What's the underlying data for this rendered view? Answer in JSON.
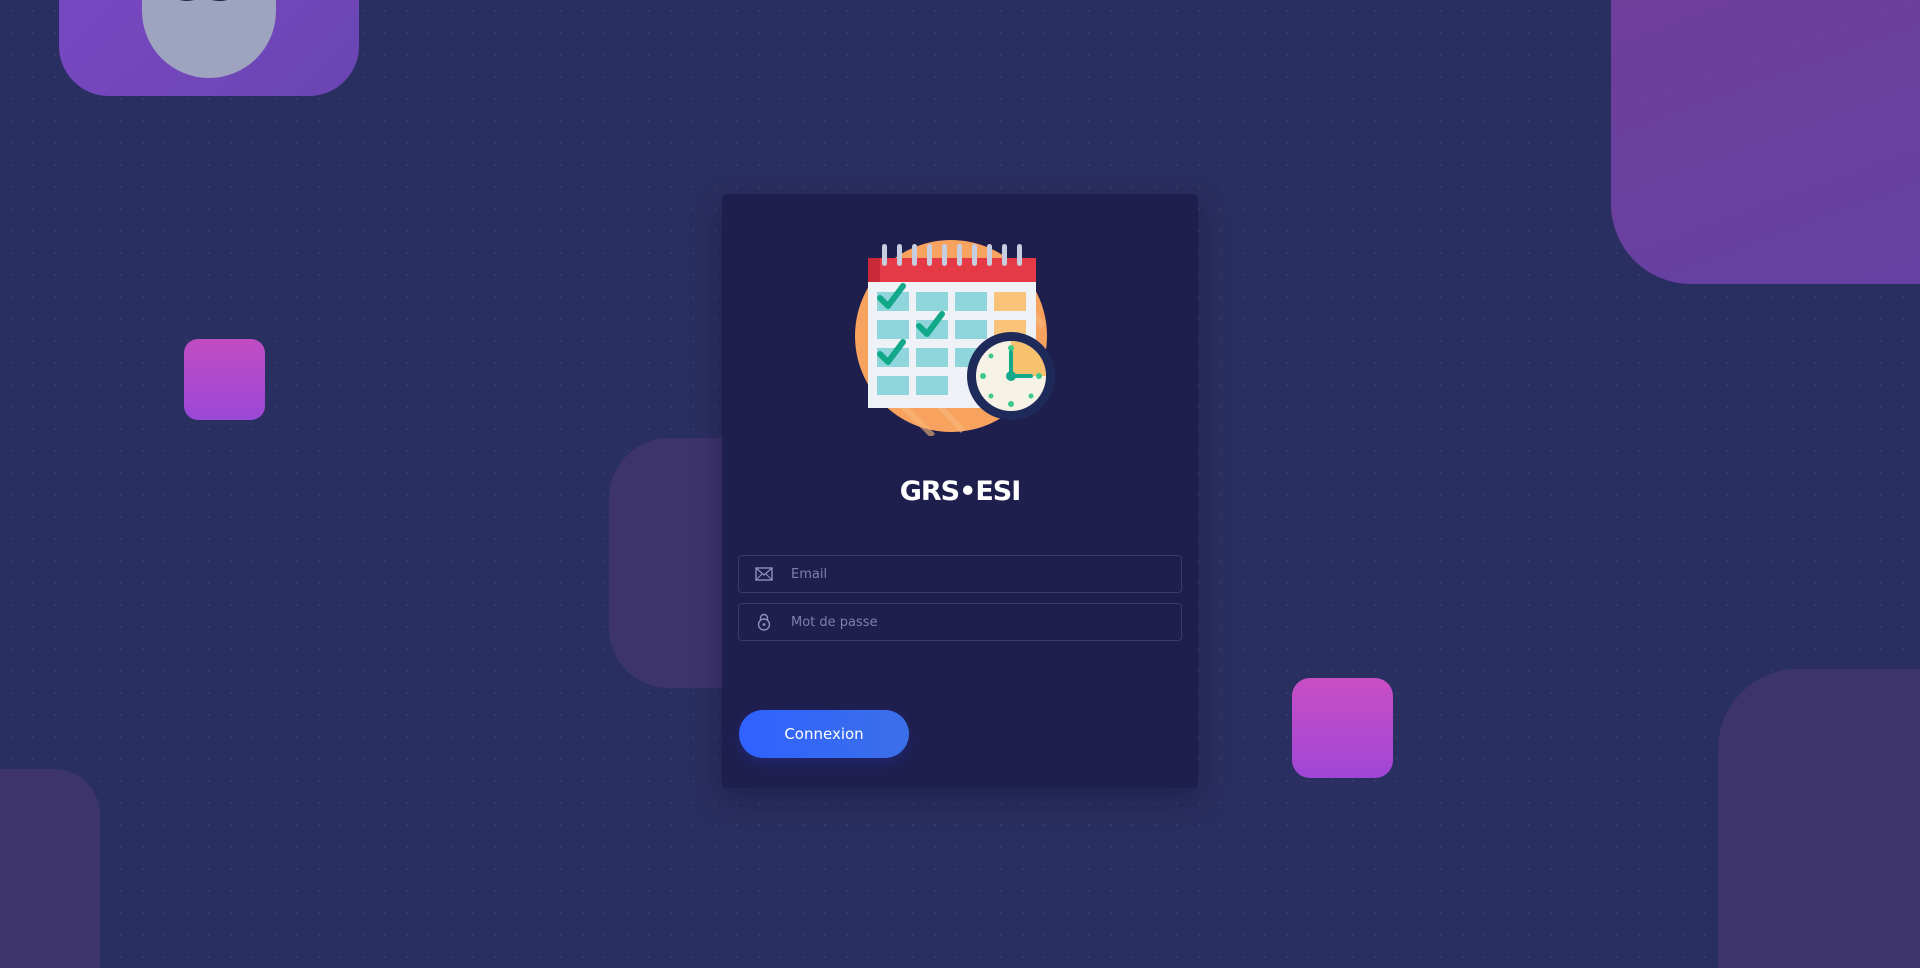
{
  "brand": {
    "logo_text": "esi",
    "app_title": "GRS•ESI"
  },
  "login_form": {
    "email": {
      "value": "",
      "placeholder": "Email",
      "icon": "mail-icon"
    },
    "password": {
      "value": "",
      "placeholder": "Mot de passe",
      "icon": "lock-icon"
    },
    "submit_label": "Connexion"
  },
  "illustration": {
    "icon": "calendar-clock-icon"
  },
  "colors": {
    "background": "#2a2f61",
    "card": "#1f1f4e",
    "button": "#2f62ff",
    "accent_purple": "#7a48c2",
    "accent_pink": "#c14cc2",
    "calendar_red": "#e63946",
    "calendar_orange": "#f7a25e",
    "check_green": "#12a98a"
  }
}
